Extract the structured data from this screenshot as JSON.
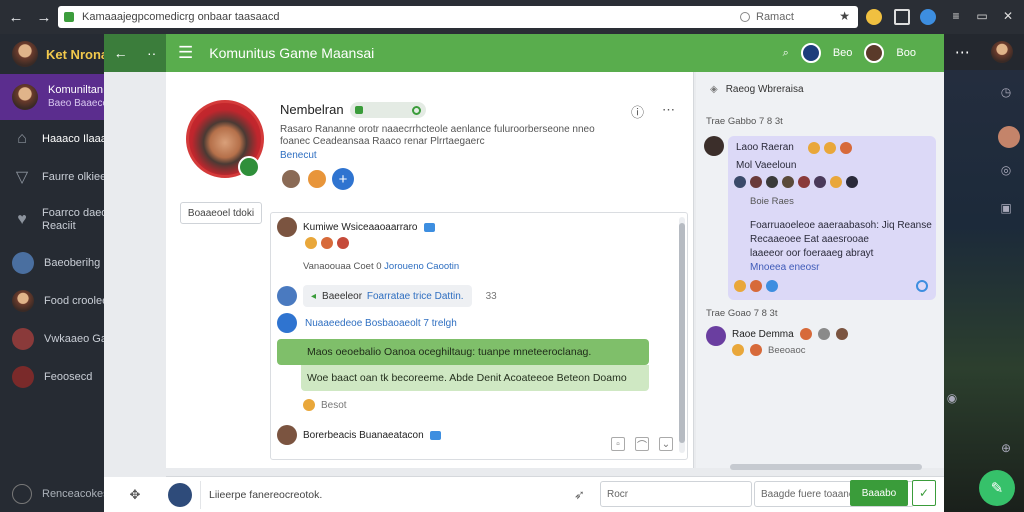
{
  "browser": {
    "url": "Kamaaajegpcomedicrg onbaar taasaacd",
    "search_label": "Ramact",
    "star_icon": "star-icon"
  },
  "app": {
    "name": "Ket Nrona",
    "sidebar": [
      {
        "title": "Komuniltan",
        "subtitle": "Baeo Baaeccet",
        "active": true
      },
      {
        "title": "Haaaco Ilaaaa",
        "chev": "⌄"
      },
      {
        "title": "Faurre olkiee",
        "chev": ""
      },
      {
        "title": "Foarrco daeoo",
        "subtitle": "Reaciit",
        "chev": "›"
      },
      {
        "title": "Baeoberihg",
        "chev": "›"
      },
      {
        "title": "Food croolee",
        "chev": "⊙"
      },
      {
        "title": "Vwkaaeo Garc",
        "chev": ""
      },
      {
        "title": "Feoosecd",
        "chev": ""
      }
    ],
    "bottom_label": "Renceacokes"
  },
  "header": {
    "title": "Komunitus Game Maansai",
    "right_label_1": "Beo",
    "right_label_2": "Boo"
  },
  "profile": {
    "name": "Nembelran",
    "bio": "Rasaro Rananne orotr naaecrrhcteole aenlance fuluroorberseone nneo foanec Ceadeansaa Raaco renar Plrrtaegaerc",
    "link": "Benecut",
    "tag_chip": "Boaaeoel tdoki"
  },
  "feed": {
    "post1_author": "Kumiwe Wsiceaaoaarraro",
    "post1_meta": "Vanaoouaa Coet 0",
    "post1_meta_link": "Joroueno Caootin",
    "reply_text": "Baeeleor",
    "reply_link": "Foarratae trice Dattin.",
    "reply_count": "33",
    "link_line": "Nuaaeedeoe Bosbaoaeolt 7 trelgh",
    "green_line1": "Maos oeoebalio Oanoa oceghiltaug: tuanpe mneteeroclanag.",
    "green_line2": "Woe baact oan tk becoreeme.  Abde Denit Acoateeoe Beteon Doamo",
    "reaction_label": "Besot",
    "post2_author": "Borerbeacis Buanaeatacon"
  },
  "chat": {
    "title": "Raeog Wbreraisa",
    "time1": "Trae Gabbo 7 8 3t",
    "card_name": "Laoo Raeran",
    "card_sub": "Mol Vaeeloun",
    "card_line1": "Boie Raes",
    "card_line2": "Foarruaoeleoe aaeraabasoh: Jiq Reanse",
    "card_line3": "Recaaeoee  Eat aaesrooae",
    "card_line4": "laaeeor oor foeraaeg abrayt",
    "card_line5": "Mnoeea eneosr",
    "time2": "Trae Goao 7 8 3t",
    "user2_name": "Raoe Demma",
    "user2_sub": "Beeoaoc"
  },
  "composer": {
    "placeholder": "Liieerpe fanereocreotok.",
    "field1": "Rocr",
    "field2": "Baagde fuere toaanel.",
    "send_label": "Baaabo"
  },
  "colors": {
    "header_green": "#59ad4d",
    "active_purple": "#5b2d8e",
    "accent_blue": "#2f74d0",
    "fab_green": "#36c16a"
  }
}
